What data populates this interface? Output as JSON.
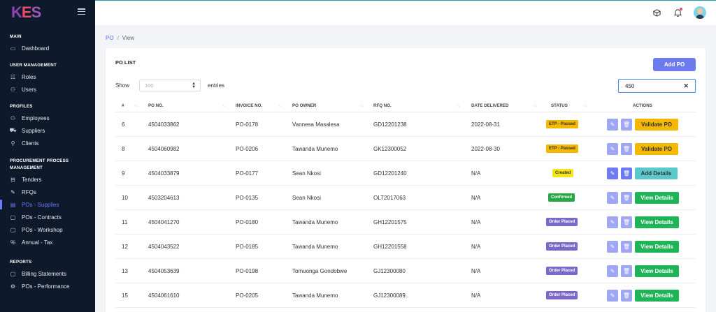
{
  "brand": {
    "logo_k": "K",
    "logo_e": "E",
    "logo_s": "S"
  },
  "sidebar": {
    "sections": [
      {
        "title": "MAIN",
        "items": [
          {
            "label": "Dashboard",
            "icon": "monitor-icon"
          }
        ]
      },
      {
        "title": "USER MANAGEMENT",
        "items": [
          {
            "label": "Roles",
            "icon": "sliders-icon"
          },
          {
            "label": "Users",
            "icon": "users-icon"
          }
        ]
      },
      {
        "title": "PROFILES",
        "items": [
          {
            "label": "Employees",
            "icon": "users-icon"
          },
          {
            "label": "Suppliers",
            "icon": "truck-icon"
          },
          {
            "label": "Clients",
            "icon": "user-check-icon"
          }
        ]
      },
      {
        "title": "PROCUREMENT PROCESS",
        "title2": "MANAGEMENT",
        "items": [
          {
            "label": "Tenders",
            "icon": "inbox-icon"
          },
          {
            "label": "RFQs",
            "icon": "pen-icon"
          },
          {
            "label": "POs - Supplies",
            "icon": "clipboard-icon",
            "active": true
          },
          {
            "label": "POs - Contracts",
            "icon": "file-icon"
          },
          {
            "label": "POs - Workshop",
            "icon": "file-icon"
          },
          {
            "label": "Annual - Tax",
            "icon": "percent-icon"
          }
        ]
      },
      {
        "title": "REPORTS",
        "items": [
          {
            "label": "Billing Statements",
            "icon": "file-icon"
          },
          {
            "label": "POs - Performance",
            "icon": "gear-icon"
          }
        ]
      }
    ]
  },
  "breadcrumb": {
    "root": "PO",
    "separator": "/",
    "current": "View"
  },
  "card": {
    "title": "PO LIST",
    "add_button": "Add PO"
  },
  "filters": {
    "show_label": "Show",
    "entries_value": "100",
    "entries_label": "entries",
    "search_value": "450"
  },
  "table": {
    "headers": {
      "num": "#",
      "po_no": "PO NO.",
      "invoice_no": "INVOICE NO.",
      "po_owner": "PO OWNER",
      "rfq_no": "RFQ NO.",
      "date_delivered": "DATE DELIVERED",
      "status": "STATUS",
      "actions": "ACTIONS"
    },
    "rows": [
      {
        "num": "6",
        "po_no": "4504033862",
        "invoice_no": "PO-0178",
        "owner": "Vannesa Masalesa",
        "rfq": "GD12201238",
        "date": "2022-08-31",
        "status": "ETP - Passed",
        "status_type": "etp",
        "action": "Validate PO",
        "action_type": "validate"
      },
      {
        "num": "8",
        "po_no": "4504060982",
        "invoice_no": "PO-0206",
        "owner": "Tawanda Munemo",
        "rfq": "GK12300052",
        "date": "2022-08-30",
        "status": "ETP - Passed",
        "status_type": "etp",
        "action": "Validate PO",
        "action_type": "validate"
      },
      {
        "num": "9",
        "po_no": "4504033879",
        "invoice_no": "PO-0177",
        "owner": "Sean Nkosi",
        "rfq": "GD12201240",
        "date": "N/A",
        "status": "Created",
        "status_type": "created",
        "action": "Add Details",
        "action_type": "add"
      },
      {
        "num": "10",
        "po_no": "4503204613",
        "invoice_no": "PO-0135",
        "owner": "Sean Nkosi",
        "rfq": "OLT2017063",
        "date": "N/A",
        "status": "Confirmed",
        "status_type": "confirmed",
        "action": "View Details",
        "action_type": "view"
      },
      {
        "num": "11",
        "po_no": "4504041270",
        "invoice_no": "PO-0180",
        "owner": "Tawanda Munemo",
        "rfq": "GH12201575",
        "date": "N/A",
        "status": "Order Placed",
        "status_type": "placed",
        "action": "View Details",
        "action_type": "view"
      },
      {
        "num": "12",
        "po_no": "4504043522",
        "invoice_no": "PO-0185",
        "owner": "Tawanda Munemo",
        "rfq": "GH12201558",
        "date": "N/A",
        "status": "Order Placed",
        "status_type": "placed",
        "action": "View Details",
        "action_type": "view"
      },
      {
        "num": "13",
        "po_no": "4504053639",
        "invoice_no": "PO-0198",
        "owner": "Tomuonga Gondobwe",
        "rfq": "GJ12300080",
        "date": "N/A",
        "status": "Order Placed",
        "status_type": "placed",
        "action": "View Details",
        "action_type": "view"
      },
      {
        "num": "15",
        "po_no": "4504061610",
        "invoice_no": "PO-0205",
        "owner": "Tawanda Munemo",
        "rfq": "GJ12300089..",
        "date": "N/A",
        "status": "Order Placed",
        "status_type": "placed",
        "action": "View Details",
        "action_type": "view"
      }
    ]
  },
  "colors": {
    "sidebar_bg": "#0e1a2b",
    "accent": "#6c7cef",
    "active_nav": "#6c7cff",
    "warning": "#f5b800",
    "success": "#20b458",
    "info": "#5bc9cc",
    "placed": "#7b68c9"
  }
}
